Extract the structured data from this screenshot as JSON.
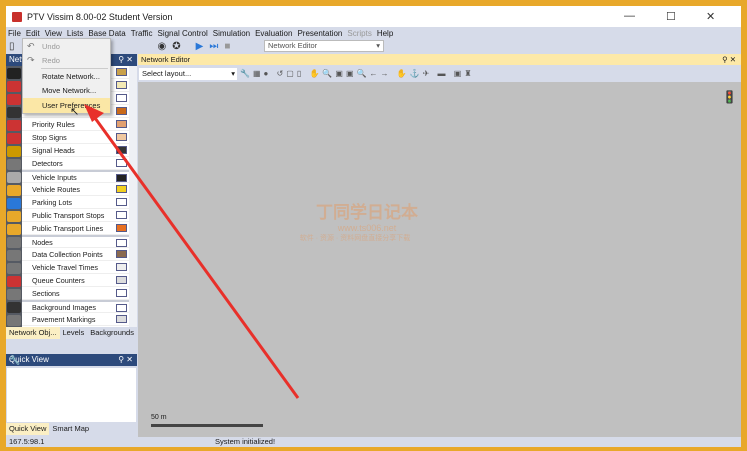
{
  "window": {
    "title": "PTV Vissim 8.00-02 Student Version",
    "minimize": "—",
    "maximize": "☐",
    "close": "✕"
  },
  "menubar": [
    "File",
    "Edit",
    "View",
    "Lists",
    "Base Data",
    "Traffic",
    "Signal Control",
    "Simulation",
    "Evaluation",
    "Presentation",
    "Scripts",
    "Help"
  ],
  "toolbar": {
    "view_combo": "Network Editor"
  },
  "edit_menu": {
    "items": [
      {
        "label": "Undo",
        "icon": "undo-icon",
        "disabled": true
      },
      {
        "label": "Redo",
        "icon": "redo-icon",
        "disabled": true
      },
      {
        "label": "Rotate Network...",
        "separator_before": true
      },
      {
        "label": "Move Network..."
      },
      {
        "label": "User Preferences",
        "highlighted": true
      }
    ]
  },
  "left_panel": {
    "title": "Network Objects",
    "title_visible": "Netw",
    "objects": [
      "",
      "",
      "",
      "",
      "Priority Rules",
      "Stop Signs",
      "Signal Heads",
      "Detectors",
      "Vehicle Inputs",
      "Vehicle Routes",
      "Parking Lots",
      "Public Transport Stops",
      "Public Transport Lines",
      "Nodes",
      "Data Collection Points",
      "Vehicle Travel Times",
      "Queue Counters",
      "Sections",
      "Background Images",
      "Pavement Markings"
    ],
    "tabs": [
      "Network Obj...",
      "Levels",
      "Backgrounds"
    ]
  },
  "quick_view": {
    "title": "Quick View",
    "tabs": [
      "Quick View",
      "Smart Map"
    ]
  },
  "editor": {
    "title": "Network Editor",
    "layout_select": "Select layout...",
    "scale_label": "50 m"
  },
  "status": {
    "coords": "167.5:98.1",
    "message": "System initialized!"
  },
  "watermark": {
    "title": "丁同学日记本",
    "url": "www.ts006.net",
    "tagline": "软件 · 资源 · 资料网盘直接分享下载"
  },
  "colors": {
    "accent": "#e8a82a",
    "arrow": "#e8302a",
    "highlight": "#fbe7a6"
  }
}
